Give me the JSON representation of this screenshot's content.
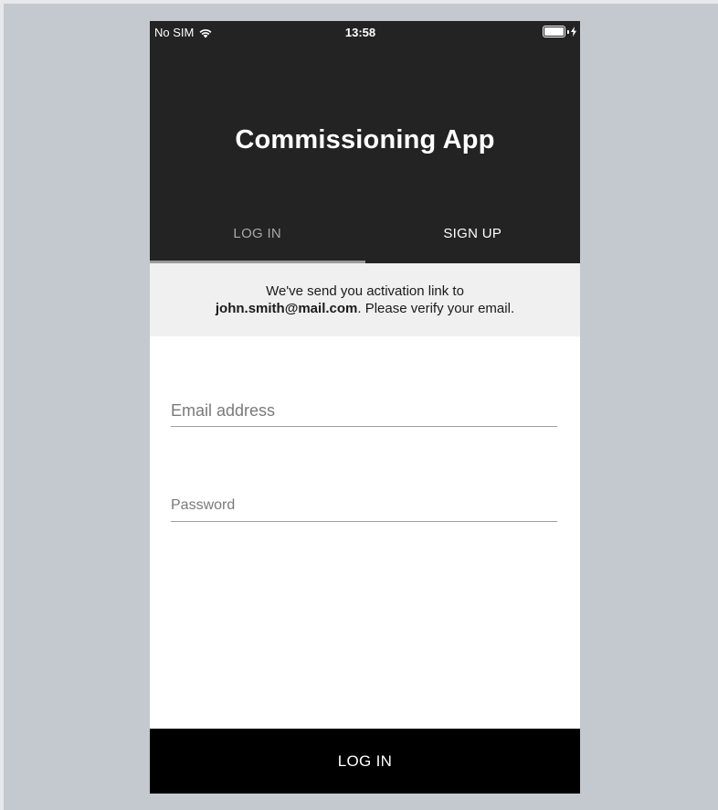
{
  "status_bar": {
    "carrier": "No SIM",
    "time": "13:58",
    "wifi_icon": "wifi-icon",
    "battery_icon": "battery-charging-icon"
  },
  "header": {
    "title": "Commissioning App",
    "background": "#232323"
  },
  "tabs": [
    {
      "label": "LOG IN",
      "selected": true
    },
    {
      "label": "SIGN UP",
      "selected": false
    }
  ],
  "notice": {
    "line1": "We've send you activation link to",
    "email": "john.smith@mail.com",
    "line2_suffix": ". Please verify your email."
  },
  "form": {
    "email_placeholder": "Email address",
    "password_placeholder": "Password"
  },
  "login_button": {
    "label": "LOG IN"
  },
  "colors": {
    "backdrop": "#c4c8cf",
    "notice_bg": "#f0f0f0",
    "button_bg": "#000000"
  }
}
